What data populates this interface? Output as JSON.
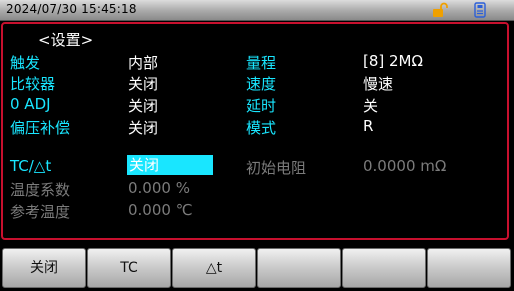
{
  "status_bar": {
    "datetime": "2024/07/30  15:45:18",
    "icons": [
      "unlock-icon",
      "usb-icon"
    ],
    "lock_color": "#f0a000",
    "usb_color": "#2b5fd9"
  },
  "page": {
    "title": "<设置>"
  },
  "settings": [
    {
      "label": "触发",
      "value": "内部"
    },
    {
      "label": "比较器",
      "value": "关闭"
    },
    {
      "label": "0 ADJ",
      "value": "关闭"
    },
    {
      "label": "偏压补偿",
      "value": "关闭"
    }
  ],
  "settings_right": [
    {
      "label": "量程",
      "value": "[8] 2MΩ"
    },
    {
      "label": "速度",
      "value": "慢速"
    },
    {
      "label": "延时",
      "value": "关"
    },
    {
      "label": "模式",
      "value": "R"
    }
  ],
  "temperature": {
    "tc_label": "TC/△t",
    "tc_value": "关闭",
    "coef_label": "温度系数",
    "coef_value": "0.000 %",
    "ref_label": "参考温度",
    "ref_value": "0.000 ℃",
    "init_res_label": "初始电阻",
    "init_res_value": "0.0000 mΩ"
  },
  "softkeys": [
    "关闭",
    "TC",
    "△t",
    "",
    "",
    ""
  ],
  "colors": {
    "accent": "#19e6ff",
    "frame": "#c8102e",
    "inactive": "#7b7b7b"
  }
}
